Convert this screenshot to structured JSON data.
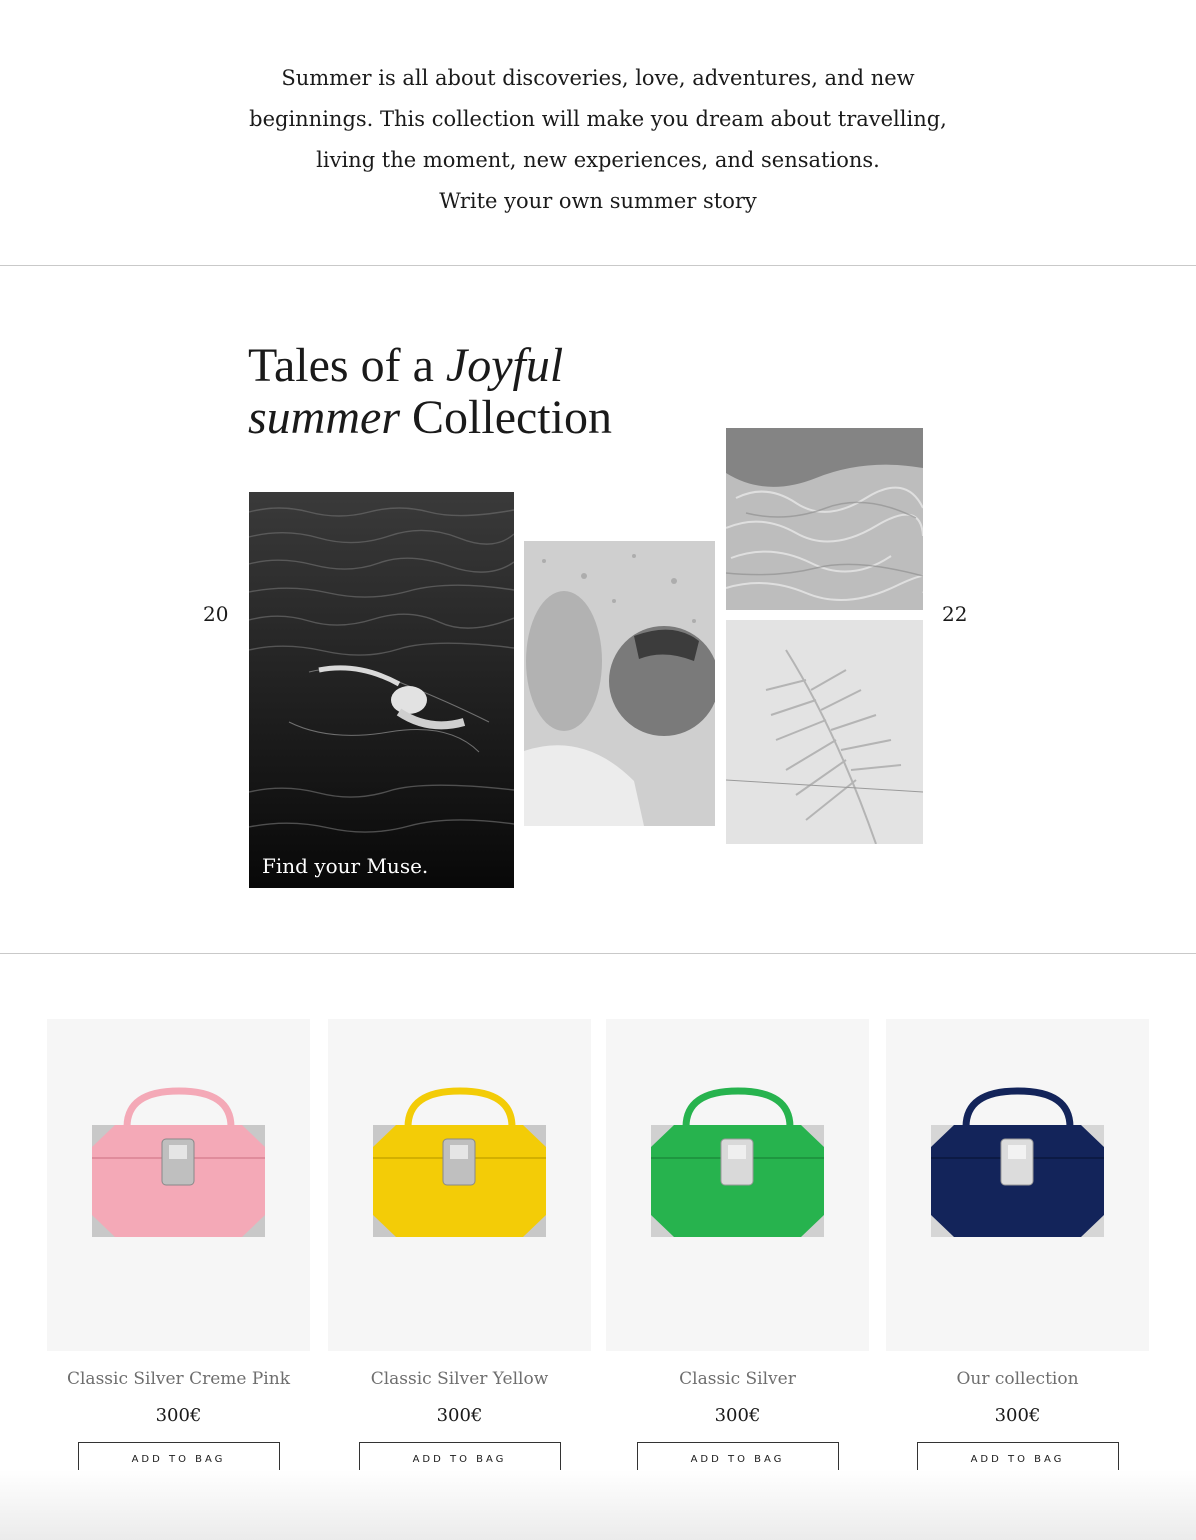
{
  "intro": {
    "lines": [
      "Summer is all about discoveries, love, adventures, and new",
      "beginnings. This collection will make you dream about travelling,",
      "living the moment, new experiences, and sensations.",
      "Write your own summer story"
    ]
  },
  "collection": {
    "title_part1": "Tales of a ",
    "title_italic1": "Joyful",
    "title_italic2": "summer",
    "title_part2": " Collection",
    "year_left": "20",
    "year_right": "22",
    "caption": "Find your Muse."
  },
  "products": [
    {
      "name": "Classic Silver Creme Pink",
      "price": "300€",
      "button": "ADD TO BAG",
      "color": "#f4a9b7"
    },
    {
      "name": "Classic Silver Yellow",
      "price": "300€",
      "button": "ADD TO BAG",
      "color": "#f3cc07"
    },
    {
      "name": "Classic Silver",
      "price": "300€",
      "button": "ADD TO BAG",
      "color": "#27b34e"
    },
    {
      "name": "Our collection",
      "price": "300€",
      "button": "ADD TO BAG",
      "color": "#13245a"
    }
  ]
}
